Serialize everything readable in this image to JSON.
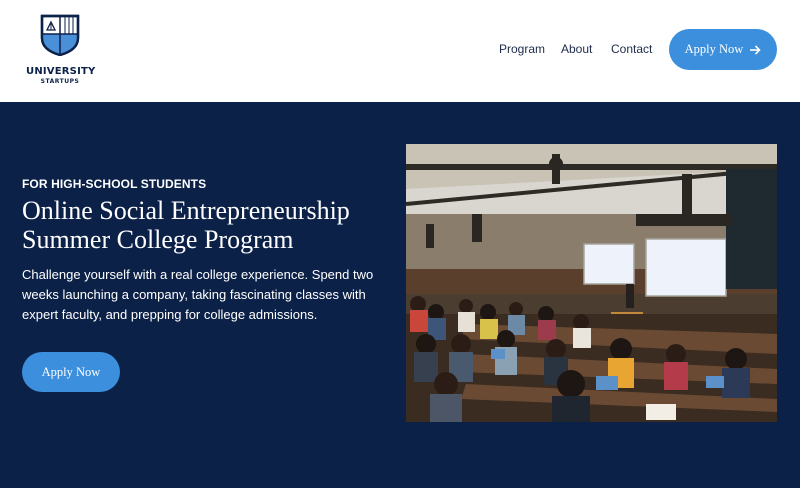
{
  "brand": {
    "name": "UNIVERSITY",
    "tagline": "STARTUPS",
    "colors": {
      "navy": "#0c2148",
      "accent": "#3c8fdc",
      "logo_blue": "#4a90d9"
    }
  },
  "nav": {
    "items": [
      {
        "label": "Program"
      },
      {
        "label": "About"
      },
      {
        "label": "Contact"
      }
    ],
    "cta": {
      "label": "Apply Now",
      "icon": "arrow-right-icon"
    }
  },
  "hero": {
    "eyebrow": "FOR HIGH-SCHOOL STUDENTS",
    "title": "Online Social Entrepreneurship Summer College Program",
    "description": "Challenge yourself with a real college experience. Spend two weeks launching a company, taking fascinating classes with expert faculty, and prepping for college admissions.",
    "cta_label": "Apply Now"
  }
}
